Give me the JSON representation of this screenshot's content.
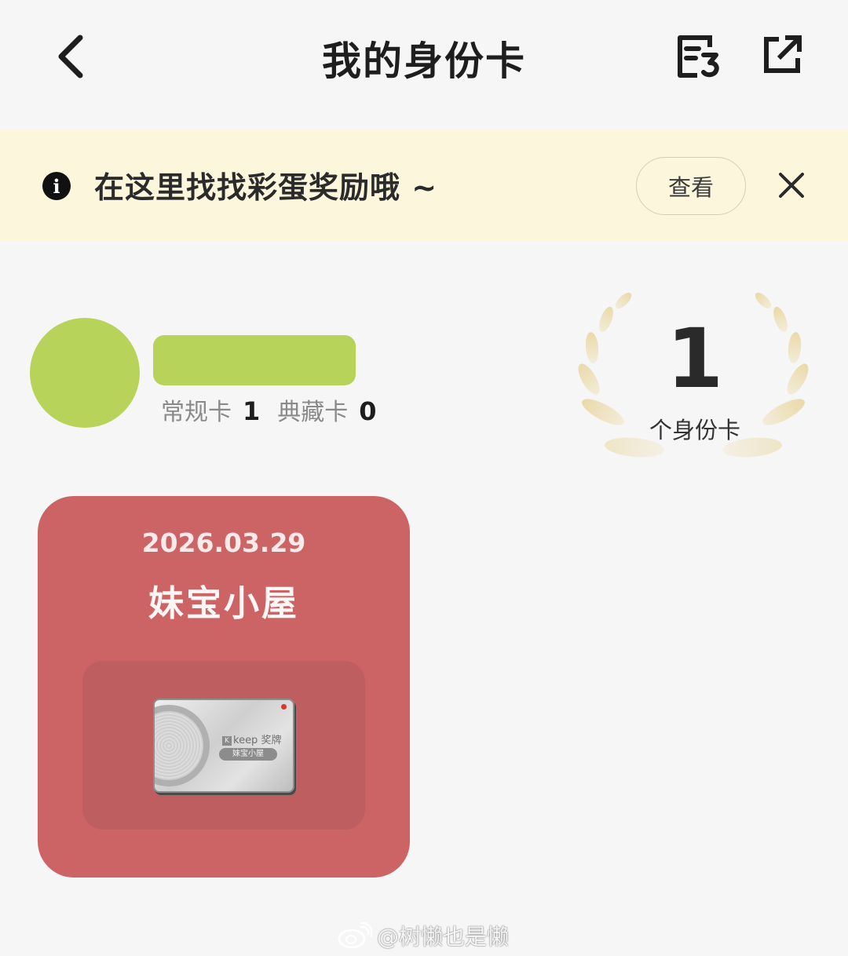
{
  "header": {
    "title": "我的身份卡",
    "back_icon": "chevron-left-icon",
    "doc_icon": "document-icon",
    "share_icon": "external-share-icon"
  },
  "notice": {
    "text": "在这里找找彩蛋奖励哦 ~",
    "view_label": "查看",
    "info_icon": "info-icon",
    "close_icon": "close-icon",
    "background": "#fcf6dc"
  },
  "profile": {
    "regular_label": "常规卡",
    "regular_count": "1",
    "collection_label": "典藏卡",
    "collection_count": "0",
    "avatar_color": "#b8d359"
  },
  "summary": {
    "total": "1",
    "label": "个身份卡"
  },
  "card": {
    "date": "2026.03.29",
    "name": "妹宝小屋",
    "medal_brand": "keep 奖牌",
    "medal_name": "妹宝小屋",
    "color": "#cc6466"
  },
  "watermark": {
    "text": "@树懒也是懒",
    "icon": "weibo-icon"
  }
}
